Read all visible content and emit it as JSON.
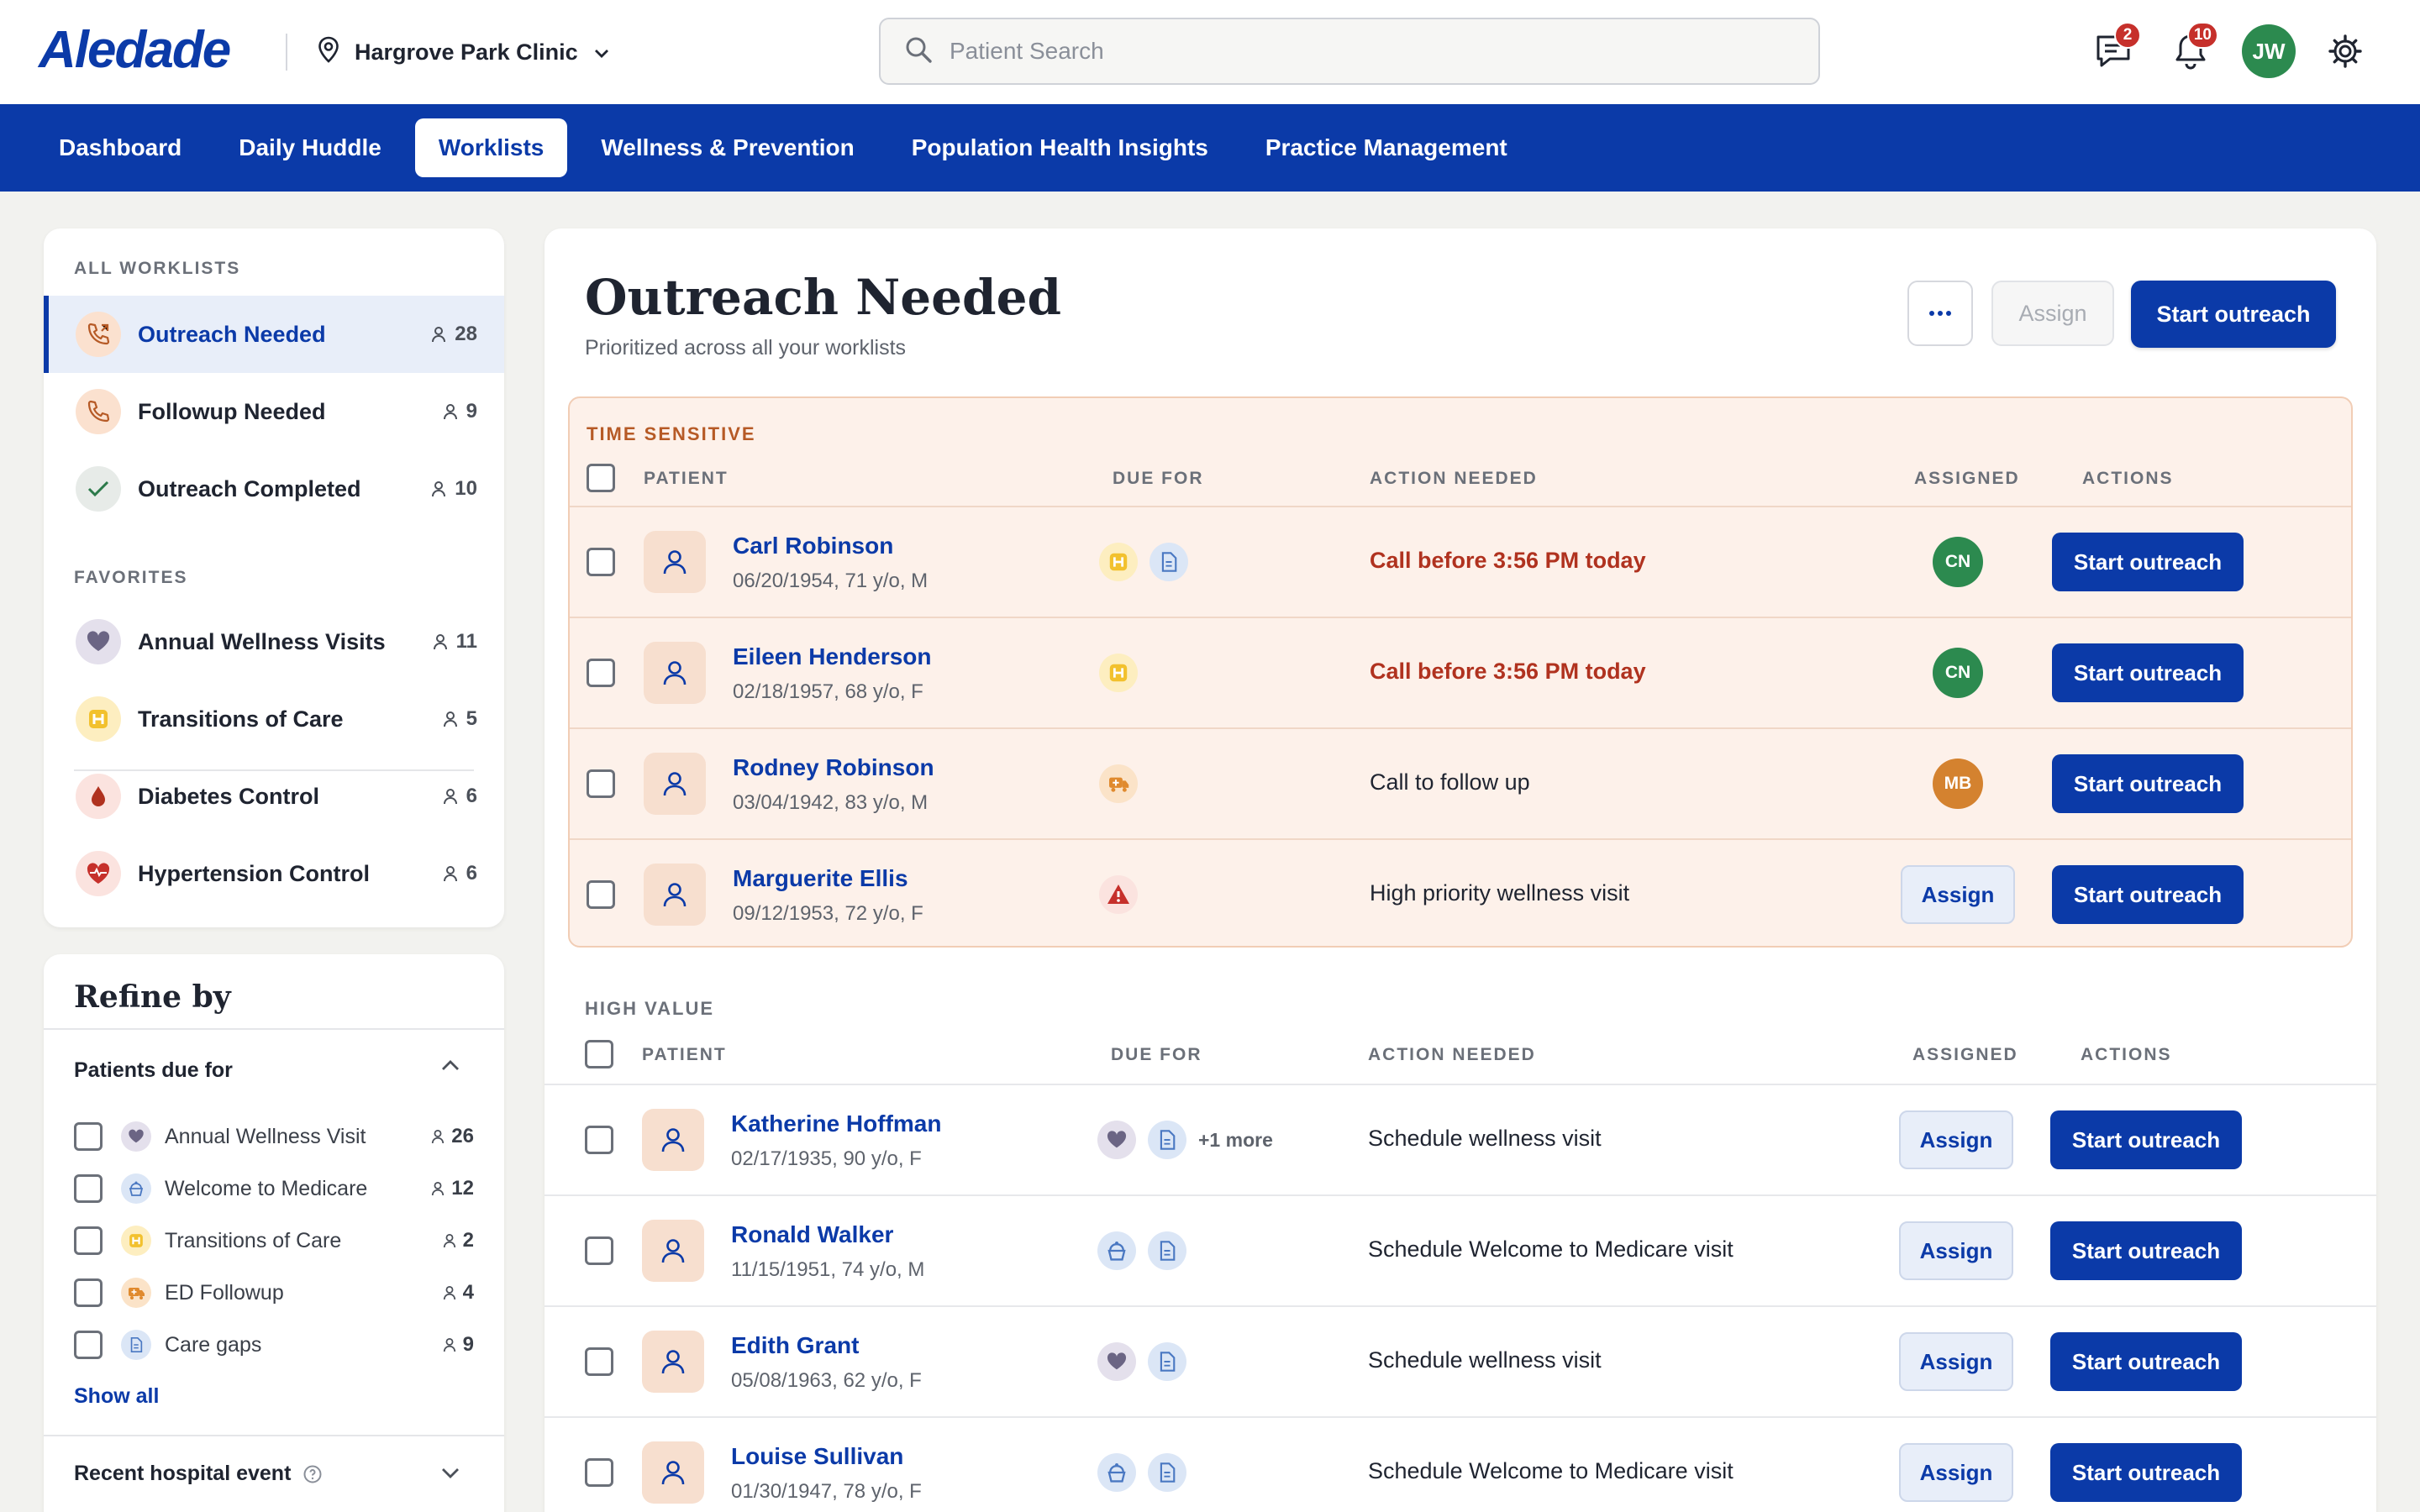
{
  "header": {
    "logo": "Aledade",
    "clinic": "Hargrove Park Clinic",
    "search_placeholder": "Patient Search",
    "messages_badge": "2",
    "notifications_badge": "10",
    "user_initials": "JW"
  },
  "nav": {
    "tabs": [
      "Dashboard",
      "Daily Huddle",
      "Worklists",
      "Wellness & Prevention",
      "Population Health Insights",
      "Practice Management"
    ],
    "active": "Worklists"
  },
  "sidebar": {
    "all_title": "ALL WORKLISTS",
    "all_items": [
      {
        "label": "Outreach Needed",
        "count": "28"
      },
      {
        "label": "Followup Needed",
        "count": "9"
      },
      {
        "label": "Outreach Completed",
        "count": "10"
      }
    ],
    "fav_title": "FAVORITES",
    "fav_items": [
      {
        "label": "Annual Wellness Visits",
        "count": "11"
      },
      {
        "label": "Transitions of Care",
        "count": "5"
      },
      {
        "label": "Diabetes Control",
        "count": "6"
      },
      {
        "label": "Hypertension Control",
        "count": "6"
      }
    ]
  },
  "refine": {
    "title": "Refine by",
    "due_head": "Patients due for",
    "filters": [
      {
        "label": "Annual Wellness Visit",
        "count": "26"
      },
      {
        "label": "Welcome to Medicare",
        "count": "12"
      },
      {
        "label": "Transitions of Care",
        "count": "2"
      },
      {
        "label": "ED Followup",
        "count": "4"
      },
      {
        "label": "Care gaps",
        "count": "9"
      }
    ],
    "show_all": "Show all",
    "hospital_head": "Recent hospital event"
  },
  "main": {
    "title": "Outreach Needed",
    "subtitle": "Prioritized across all your worklists",
    "assign_label": "Assign",
    "start_label": "Start outreach",
    "columns": {
      "patient": "PATIENT",
      "due": "DUE FOR",
      "action": "ACTION NEEDED",
      "assigned": "ASSIGNED",
      "actions": "ACTIONS"
    },
    "time_sensitive": {
      "label": "TIME SENSITIVE",
      "rows": [
        {
          "name": "Carl Robinson",
          "meta": "06/20/1954, 71 y/o, M",
          "action": "Call before 3:56 PM today",
          "assignee": "CN"
        },
        {
          "name": "Eileen Henderson",
          "meta": "02/18/1957, 68 y/o, F",
          "action": "Call before 3:56 PM today",
          "assignee": "CN"
        },
        {
          "name": "Rodney Robinson",
          "meta": "03/04/1942, 83 y/o, M",
          "action": "Call to follow up",
          "assignee": "MB"
        },
        {
          "name": "Marguerite Ellis",
          "meta": "09/12/1953, 72 y/o, F",
          "action": "High priority wellness visit",
          "assignee": ""
        }
      ]
    },
    "high_value": {
      "label": "HIGH VALUE",
      "rows": [
        {
          "name": "Katherine Hoffman",
          "meta": "02/17/1935, 90 y/o, F",
          "action": "Schedule wellness visit",
          "more": "+1 more"
        },
        {
          "name": "Ronald Walker",
          "meta": "11/15/1951, 74 y/o, M",
          "action": "Schedule Welcome to Medicare visit"
        },
        {
          "name": "Edith Grant",
          "meta": "05/08/1963, 62 y/o, F",
          "action": "Schedule wellness visit"
        },
        {
          "name": "Louise Sullivan",
          "meta": "01/30/1947, 78 y/o, F",
          "action": "Schedule Welcome to Medicare visit"
        }
      ]
    }
  },
  "colors": {
    "brand": "#0b3aa8",
    "urgent": "#b0321f",
    "cn": "#2c8a4f",
    "mb": "#d4822f"
  }
}
